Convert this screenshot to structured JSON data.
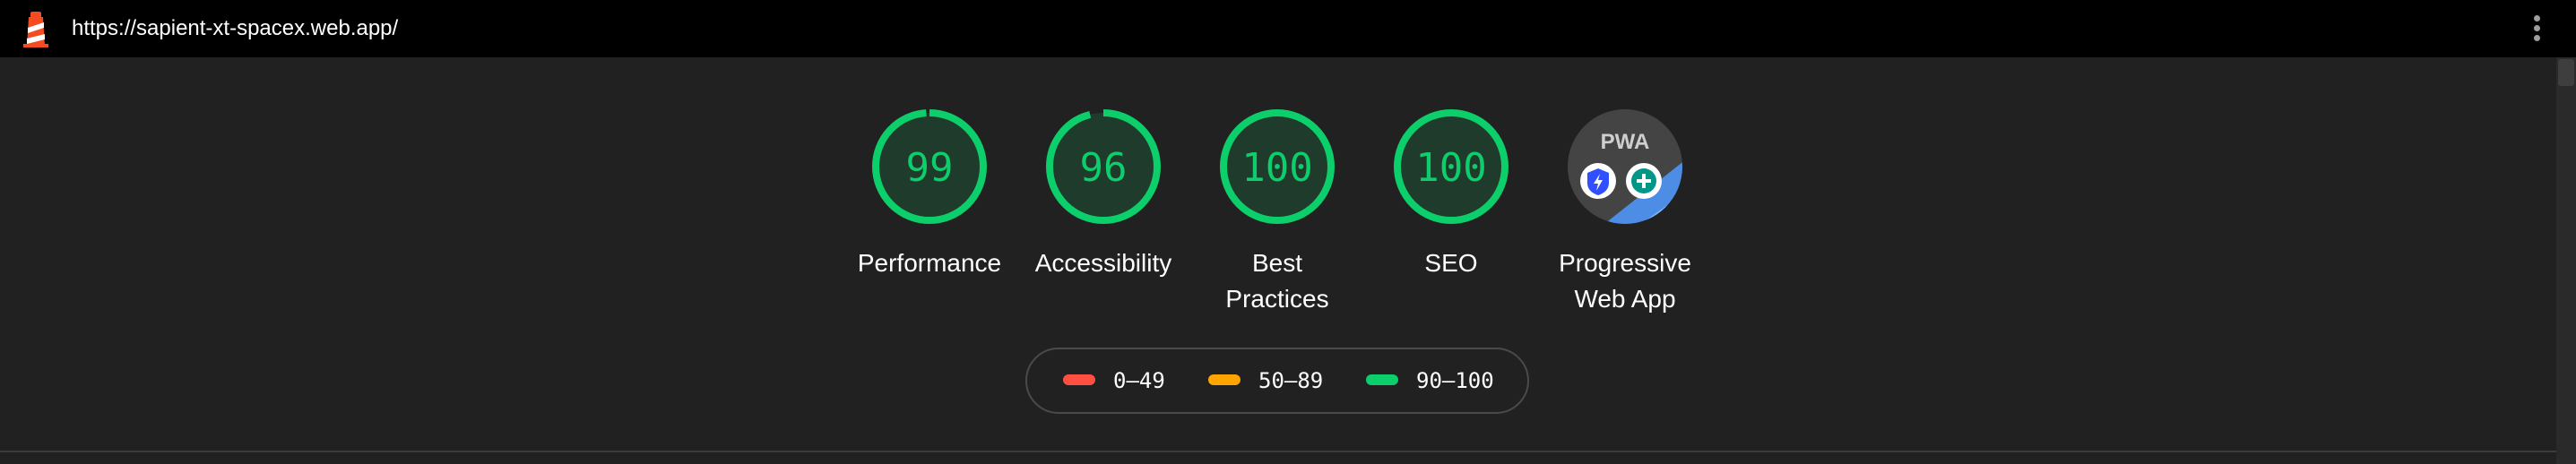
{
  "browser": {
    "url": "https://sapient-xt-spacex.web.app/",
    "logo_icon": "lighthouse-icon",
    "menu_icon": "kebab-menu-icon"
  },
  "scores": [
    {
      "label": "Performance",
      "value": "99",
      "fraction": 0.99
    },
    {
      "label": "Accessibility",
      "value": "96",
      "fraction": 0.96
    },
    {
      "label": "Best Practices",
      "value": "100",
      "fraction": 1.0
    },
    {
      "label": "SEO",
      "value": "100",
      "fraction": 1.0
    }
  ],
  "pwa": {
    "label": "Progressive Web App",
    "badge_text": "PWA",
    "badge_icons": [
      "fast-reliable-icon",
      "installable-icon"
    ]
  },
  "legend": [
    {
      "range": "0–49",
      "color": "#ff4e42"
    },
    {
      "range": "50–89",
      "color": "#ffa400"
    },
    {
      "range": "90–100",
      "color": "#0cce6b"
    }
  ],
  "colors": {
    "pass": "#0cce6b",
    "pass_fill": "#1f3b2b",
    "background": "#212121",
    "topbar": "#000000"
  }
}
